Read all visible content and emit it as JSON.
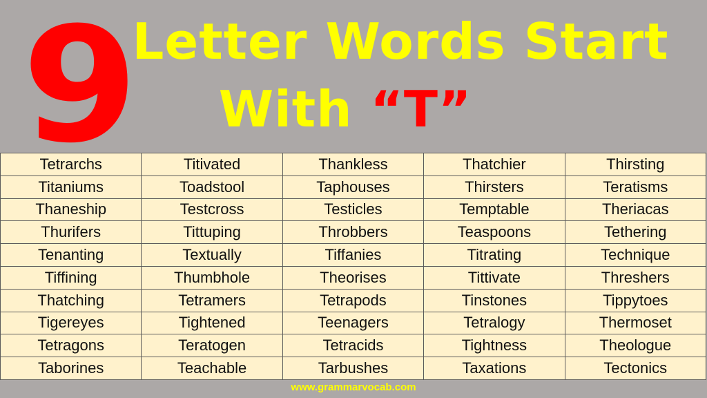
{
  "header": {
    "number": "9",
    "title_line1": "Letter Words Start",
    "title_line2_prefix": "With ",
    "title_line2_accent": "“T”",
    "colors": {
      "background": "#aca8a7",
      "number": "#ff0000",
      "title": "#ffff00",
      "accent": "#ff0000",
      "table_fill": "#fff2cc"
    }
  },
  "table": {
    "rows": [
      [
        "Tetrarchs",
        "Titivated",
        "Thankless",
        "Thatchier",
        "Thirsting"
      ],
      [
        "Titaniums",
        "Toadstool",
        "Taphouses",
        "Thirsters",
        "Teratisms"
      ],
      [
        "Thaneship",
        "Testcross",
        "Testicles",
        "Temptable",
        "Theriacas"
      ],
      [
        "Thurifers",
        "Tittuping",
        "Throbbers",
        "Teaspoons",
        "Tethering"
      ],
      [
        "Tenanting",
        "Textually",
        "Tiffanies",
        "Titrating",
        "Technique"
      ],
      [
        "Tiffining",
        "Thumbhole",
        "Theorises",
        "Tittivate",
        "Threshers"
      ],
      [
        "Thatching",
        "Tetramers",
        "Tetrapods",
        "Tinstones",
        "Tippytoes"
      ],
      [
        "Tigereyes",
        "Tightened",
        "Teenagers",
        "Tetralogy",
        "Thermoset"
      ],
      [
        "Tetragons",
        "Teratogen",
        "Tetracids",
        "Tightness",
        "Theologue"
      ],
      [
        "Taborines",
        "Teachable",
        "Tarbushes",
        "Taxations",
        "Tectonics"
      ]
    ]
  },
  "footer": {
    "website": "www.grammarvocab.com"
  }
}
